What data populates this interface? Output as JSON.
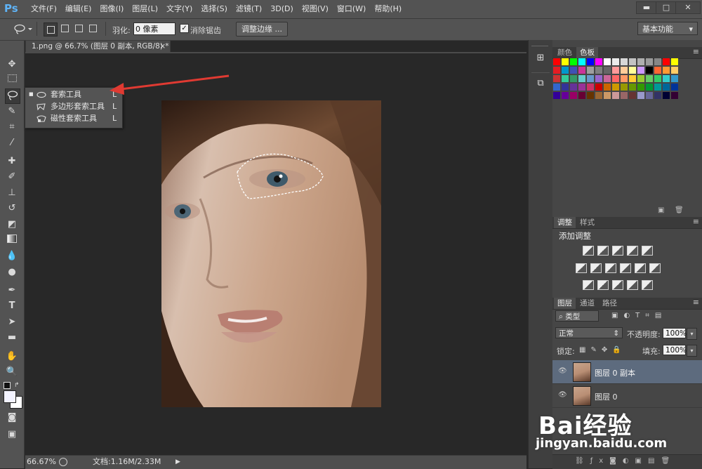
{
  "app": {
    "logo": "Ps"
  },
  "menu": [
    "文件(F)",
    "编辑(E)",
    "图像(I)",
    "图层(L)",
    "文字(Y)",
    "选择(S)",
    "滤镜(T)",
    "3D(D)",
    "视图(V)",
    "窗口(W)",
    "帮助(H)"
  ],
  "window_controls": {
    "minimize": "▬",
    "maximize": "□",
    "close": "✕"
  },
  "options": {
    "feather_label": "羽化:",
    "feather_value": "0 像素",
    "antialias_label": "消除锯齿",
    "antialias_checked": "✓",
    "refine_edge": "调整边缘 ...",
    "workspace": "基本功能"
  },
  "document": {
    "tab_title": "1.png @ 66.7% (图层 0 副本, RGB/8) *",
    "close": "×"
  },
  "flyout": {
    "items": [
      {
        "label": "套索工具",
        "key": "L",
        "selected": "■"
      },
      {
        "label": "多边形套索工具",
        "key": "L"
      },
      {
        "label": "磁性套索工具",
        "key": "L"
      }
    ]
  },
  "status": {
    "zoom": "66.67%",
    "doc_info": "文档:1.16M/2.33M"
  },
  "panels": {
    "color_tabs": [
      "颜色",
      "色板"
    ],
    "adjust_tabs": [
      "调整",
      "样式"
    ],
    "adjust_title": "添加调整",
    "layer_tabs": [
      "图层",
      "通道",
      "路径"
    ],
    "filter_kind": "类型",
    "blend_mode": "正常",
    "opacity_label": "不透明度:",
    "opacity_value": "100%",
    "lock_label": "锁定:",
    "fill_label": "填充:",
    "fill_value": "100%",
    "layers": [
      {
        "name": "图层 0 副本"
      },
      {
        "name": "图层 0"
      }
    ]
  },
  "watermark": {
    "logo": "Bai经验",
    "url": "jingyan.baidu.com"
  },
  "swatch_colors": [
    "#ff0000",
    "#ffff00",
    "#00ff00",
    "#00ffff",
    "#0000ff",
    "#ff00ff",
    "#ffffff",
    "#ebebeb",
    "#d7d7d7",
    "#c3c3c3",
    "#afafaf",
    "#9b9b9b",
    "#878787",
    "#ff0000",
    "#ffff00",
    "#e51c23",
    "#0099cc",
    "#3f51b5",
    "#cc3399",
    "#9e9e9e",
    "#7f7f7f",
    "#666666",
    "#ff9999",
    "#ffcc99",
    "#ffff99",
    "#cc99ff",
    "#000000",
    "#ff6633",
    "#ff9933",
    "#ffcc66",
    "#cc3333",
    "#33cc99",
    "#339966",
    "#66cccc",
    "#6699cc",
    "#9966cc",
    "#cc6699",
    "#ff6666",
    "#ff9966",
    "#ffcc33",
    "#99cc33",
    "#66cc66",
    "#33cc66",
    "#33cccc",
    "#3399cc",
    "#3366cc",
    "#333399",
    "#663399",
    "#993399",
    "#cc3366",
    "#cc0000",
    "#cc6600",
    "#cc9900",
    "#999900",
    "#669900",
    "#339900",
    "#009933",
    "#009999",
    "#006699",
    "#003399",
    "#330099",
    "#660099",
    "#990066",
    "#660033",
    "#663300",
    "#996633",
    "#cc9966",
    "#cc9999",
    "#996666",
    "#663333",
    "#9999cc",
    "#666699",
    "#333366",
    "#000033",
    "#330033"
  ]
}
